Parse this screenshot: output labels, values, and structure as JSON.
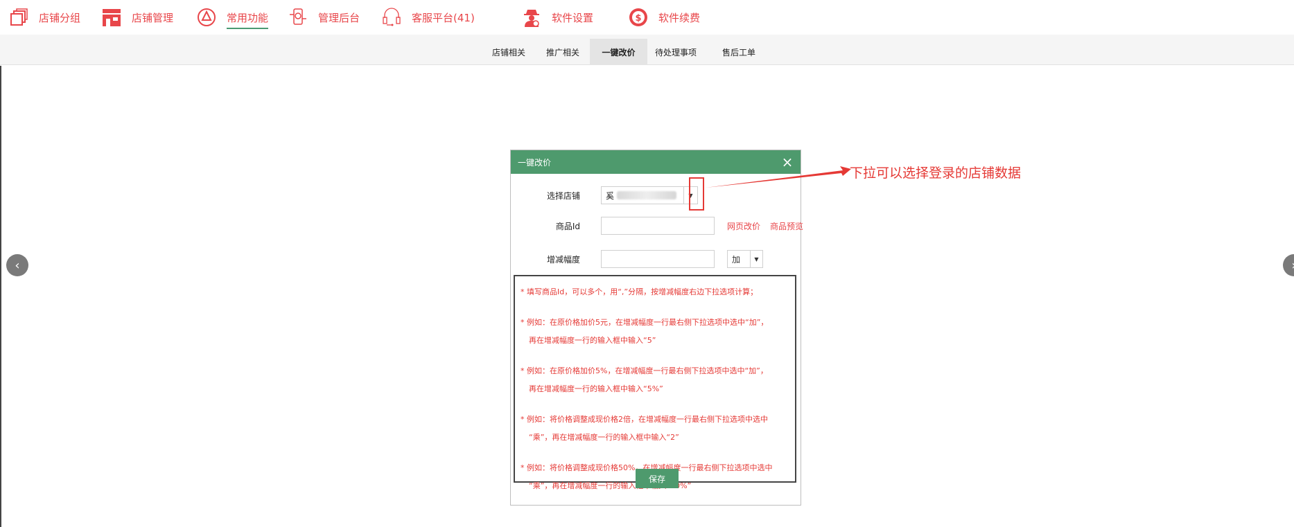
{
  "topnav": {
    "items": [
      {
        "label": "店铺分组",
        "icon": "copy-icon"
      },
      {
        "label": "店铺管理",
        "icon": "store-icon"
      },
      {
        "label": "常用功能",
        "icon": "triangle-nodes-icon"
      },
      {
        "label": "管理后台",
        "icon": "phone-settings-icon"
      },
      {
        "label": "客服平台(41)",
        "icon": "headset-icon"
      },
      {
        "label": "软件设置",
        "icon": "spy-settings-icon"
      },
      {
        "label": "软件续费",
        "icon": "dollar-coin-icon"
      }
    ]
  },
  "subnav": {
    "tabs": [
      "店铺相关",
      "推广相关",
      "一键改价",
      "待处理事项",
      "售后工单"
    ]
  },
  "dialog": {
    "title": "一键改价",
    "shop_label": "选择店铺",
    "shop_value": "奚",
    "product_label": "商品Id",
    "product_value": "",
    "web_edit_link": "网页改价",
    "preview_link": "商品预览",
    "range_label": "增减幅度",
    "range_value": "",
    "op_value": "加",
    "notes": [
      {
        "line1": "* 填写商品Id，可以多个，用“,”分隔，按增减幅度右边下拉选项计算；",
        "line2": ""
      },
      {
        "line1": "* 例如：在原价格加价5元，在增减幅度一行最右侧下拉选项中选中“加”，",
        "line2": "再在增减幅度一行的输入框中输入“5”"
      },
      {
        "line1": "* 例如：在原价格加价5%，在增减幅度一行最右侧下拉选项中选中“加”，",
        "line2": "再在增减幅度一行的输入框中输入“5%”"
      },
      {
        "line1": "* 例如：将价格调整成现价格2倍，在增减幅度一行最右侧下拉选项中选中",
        "line2": "“乘”，再在增减幅度一行的输入框中输入“2”"
      },
      {
        "line1": "* 例如：将价格调整成现价格50%，在增减幅度一行最右侧下拉选项中选中",
        "line2": "“乘”，再在增减幅度一行的输入框中输入“50%”"
      }
    ],
    "save_label": "保存"
  },
  "annotation": {
    "text": "下拉可以选择登录的店铺数据"
  },
  "colors": {
    "accent_red": "#e8464a",
    "header_green": "#4e9a6d",
    "note_red": "#e53935"
  }
}
